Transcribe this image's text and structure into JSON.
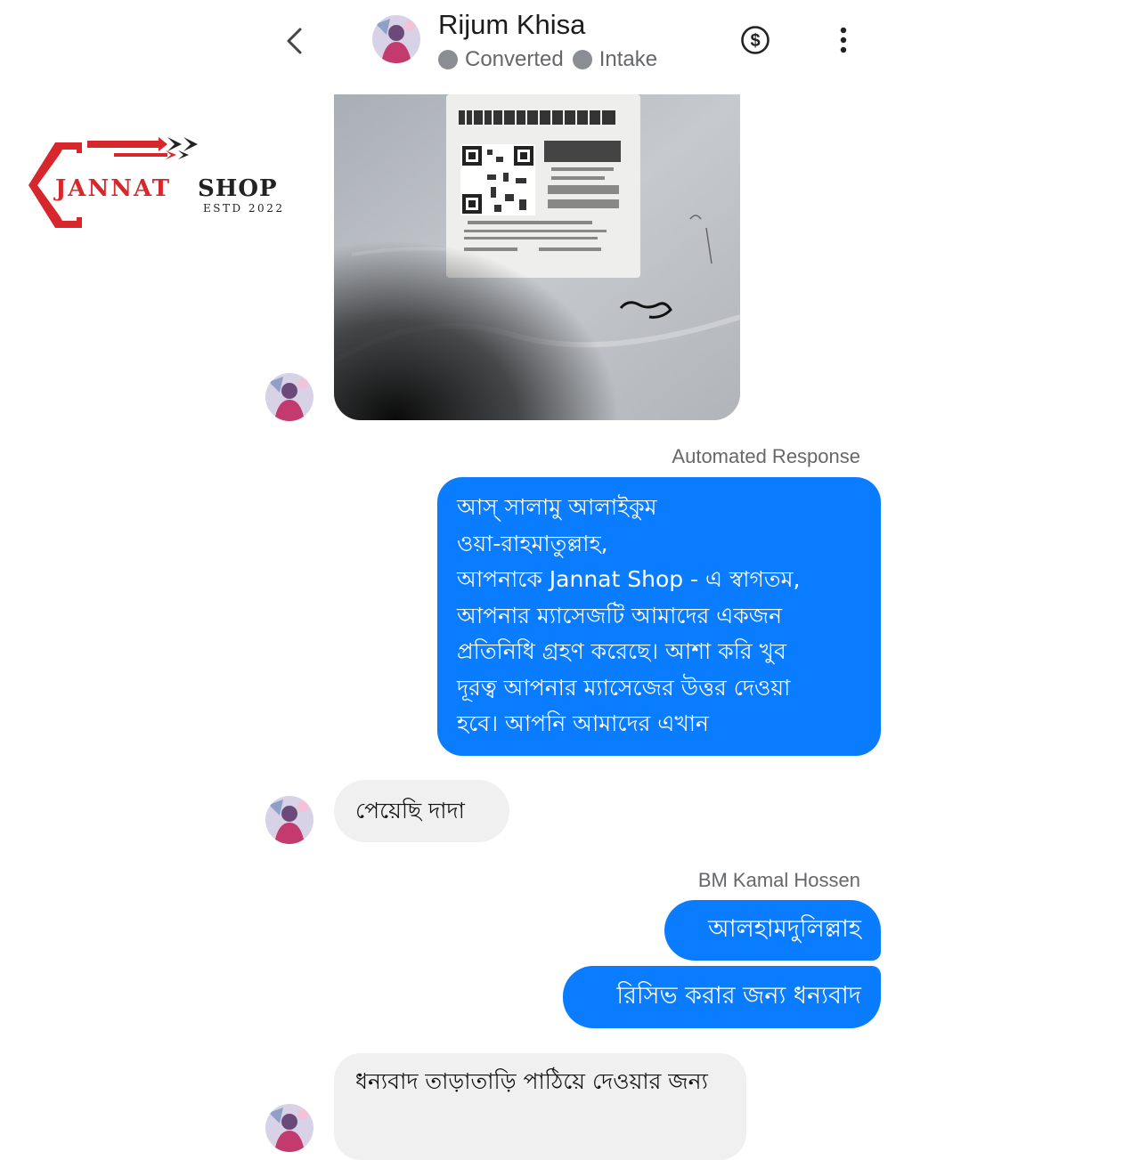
{
  "header": {
    "contact_name": "Rijum Khisa",
    "tags": [
      "Converted",
      "Intake"
    ],
    "back_icon": "chevron-left-icon",
    "payment_icon": "dollar-circle-icon",
    "menu_icon": "more-vertical-icon"
  },
  "logo": {
    "name_part1": "JANNAT",
    "name_part2": "SHOP",
    "estd": "ESTD 2022"
  },
  "messages": {
    "auto_label": "Automated Response",
    "auto_text_lines": [
      "আস্ সালামু আলাইকুম",
      "ওয়া-রাহমাতুল্লাহ,",
      "আপনাকে Jannat Shop - এ স্বাগতম,",
      "আপনার ম্যাসেজটি আমাদের একজন",
      "প্রতিনিধি গ্রহণ করেছে। আশা করি খুব",
      "দূরত্ব আপনার ম্যাসেজের উত্তর দেওয়া",
      "হবে। আপনি আমাদের এখান"
    ],
    "received_1": "পেয়েছি দাদা",
    "sender_label": "BM Kamal Hossen",
    "sent_1": "আলহামদুলিল্লাহ",
    "sent_2": "রিসিভ করার জন্য ধন্যবাদ",
    "received_2": "ধন্যবাদ তাড়াতাড়ি  পাঠিয়ে দেওয়ার জন্য"
  },
  "colors": {
    "outgoing_bubble": "#0a7cff",
    "incoming_bubble": "#f0f0f0",
    "logo_red": "#d7262c",
    "logo_dark": "#222222"
  }
}
